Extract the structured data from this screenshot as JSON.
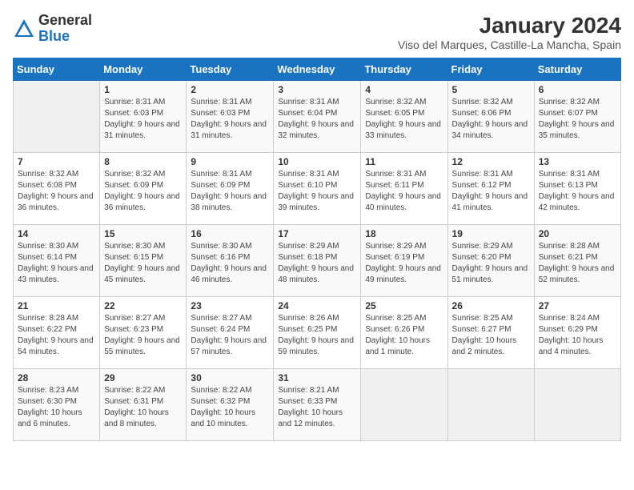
{
  "logo": {
    "general": "General",
    "blue": "Blue"
  },
  "title": "January 2024",
  "subtitle": "Viso del Marques, Castille-La Mancha, Spain",
  "days_of_week": [
    "Sunday",
    "Monday",
    "Tuesday",
    "Wednesday",
    "Thursday",
    "Friday",
    "Saturday"
  ],
  "weeks": [
    [
      {
        "day": "",
        "sunrise": "",
        "sunset": "",
        "daylight": ""
      },
      {
        "day": "1",
        "sunrise": "Sunrise: 8:31 AM",
        "sunset": "Sunset: 6:03 PM",
        "daylight": "Daylight: 9 hours and 31 minutes."
      },
      {
        "day": "2",
        "sunrise": "Sunrise: 8:31 AM",
        "sunset": "Sunset: 6:03 PM",
        "daylight": "Daylight: 9 hours and 31 minutes."
      },
      {
        "day": "3",
        "sunrise": "Sunrise: 8:31 AM",
        "sunset": "Sunset: 6:04 PM",
        "daylight": "Daylight: 9 hours and 32 minutes."
      },
      {
        "day": "4",
        "sunrise": "Sunrise: 8:32 AM",
        "sunset": "Sunset: 6:05 PM",
        "daylight": "Daylight: 9 hours and 33 minutes."
      },
      {
        "day": "5",
        "sunrise": "Sunrise: 8:32 AM",
        "sunset": "Sunset: 6:06 PM",
        "daylight": "Daylight: 9 hours and 34 minutes."
      },
      {
        "day": "6",
        "sunrise": "Sunrise: 8:32 AM",
        "sunset": "Sunset: 6:07 PM",
        "daylight": "Daylight: 9 hours and 35 minutes."
      }
    ],
    [
      {
        "day": "7",
        "sunrise": "Sunrise: 8:32 AM",
        "sunset": "Sunset: 6:08 PM",
        "daylight": "Daylight: 9 hours and 36 minutes."
      },
      {
        "day": "8",
        "sunrise": "Sunrise: 8:32 AM",
        "sunset": "Sunset: 6:09 PM",
        "daylight": "Daylight: 9 hours and 36 minutes."
      },
      {
        "day": "9",
        "sunrise": "Sunrise: 8:31 AM",
        "sunset": "Sunset: 6:09 PM",
        "daylight": "Daylight: 9 hours and 38 minutes."
      },
      {
        "day": "10",
        "sunrise": "Sunrise: 8:31 AM",
        "sunset": "Sunset: 6:10 PM",
        "daylight": "Daylight: 9 hours and 39 minutes."
      },
      {
        "day": "11",
        "sunrise": "Sunrise: 8:31 AM",
        "sunset": "Sunset: 6:11 PM",
        "daylight": "Daylight: 9 hours and 40 minutes."
      },
      {
        "day": "12",
        "sunrise": "Sunrise: 8:31 AM",
        "sunset": "Sunset: 6:12 PM",
        "daylight": "Daylight: 9 hours and 41 minutes."
      },
      {
        "day": "13",
        "sunrise": "Sunrise: 8:31 AM",
        "sunset": "Sunset: 6:13 PM",
        "daylight": "Daylight: 9 hours and 42 minutes."
      }
    ],
    [
      {
        "day": "14",
        "sunrise": "Sunrise: 8:30 AM",
        "sunset": "Sunset: 6:14 PM",
        "daylight": "Daylight: 9 hours and 43 minutes."
      },
      {
        "day": "15",
        "sunrise": "Sunrise: 8:30 AM",
        "sunset": "Sunset: 6:15 PM",
        "daylight": "Daylight: 9 hours and 45 minutes."
      },
      {
        "day": "16",
        "sunrise": "Sunrise: 8:30 AM",
        "sunset": "Sunset: 6:16 PM",
        "daylight": "Daylight: 9 hours and 46 minutes."
      },
      {
        "day": "17",
        "sunrise": "Sunrise: 8:29 AM",
        "sunset": "Sunset: 6:18 PM",
        "daylight": "Daylight: 9 hours and 48 minutes."
      },
      {
        "day": "18",
        "sunrise": "Sunrise: 8:29 AM",
        "sunset": "Sunset: 6:19 PM",
        "daylight": "Daylight: 9 hours and 49 minutes."
      },
      {
        "day": "19",
        "sunrise": "Sunrise: 8:29 AM",
        "sunset": "Sunset: 6:20 PM",
        "daylight": "Daylight: 9 hours and 51 minutes."
      },
      {
        "day": "20",
        "sunrise": "Sunrise: 8:28 AM",
        "sunset": "Sunset: 6:21 PM",
        "daylight": "Daylight: 9 hours and 52 minutes."
      }
    ],
    [
      {
        "day": "21",
        "sunrise": "Sunrise: 8:28 AM",
        "sunset": "Sunset: 6:22 PM",
        "daylight": "Daylight: 9 hours and 54 minutes."
      },
      {
        "day": "22",
        "sunrise": "Sunrise: 8:27 AM",
        "sunset": "Sunset: 6:23 PM",
        "daylight": "Daylight: 9 hours and 55 minutes."
      },
      {
        "day": "23",
        "sunrise": "Sunrise: 8:27 AM",
        "sunset": "Sunset: 6:24 PM",
        "daylight": "Daylight: 9 hours and 57 minutes."
      },
      {
        "day": "24",
        "sunrise": "Sunrise: 8:26 AM",
        "sunset": "Sunset: 6:25 PM",
        "daylight": "Daylight: 9 hours and 59 minutes."
      },
      {
        "day": "25",
        "sunrise": "Sunrise: 8:25 AM",
        "sunset": "Sunset: 6:26 PM",
        "daylight": "Daylight: 10 hours and 1 minute."
      },
      {
        "day": "26",
        "sunrise": "Sunrise: 8:25 AM",
        "sunset": "Sunset: 6:27 PM",
        "daylight": "Daylight: 10 hours and 2 minutes."
      },
      {
        "day": "27",
        "sunrise": "Sunrise: 8:24 AM",
        "sunset": "Sunset: 6:29 PM",
        "daylight": "Daylight: 10 hours and 4 minutes."
      }
    ],
    [
      {
        "day": "28",
        "sunrise": "Sunrise: 8:23 AM",
        "sunset": "Sunset: 6:30 PM",
        "daylight": "Daylight: 10 hours and 6 minutes."
      },
      {
        "day": "29",
        "sunrise": "Sunrise: 8:22 AM",
        "sunset": "Sunset: 6:31 PM",
        "daylight": "Daylight: 10 hours and 8 minutes."
      },
      {
        "day": "30",
        "sunrise": "Sunrise: 8:22 AM",
        "sunset": "Sunset: 6:32 PM",
        "daylight": "Daylight: 10 hours and 10 minutes."
      },
      {
        "day": "31",
        "sunrise": "Sunrise: 8:21 AM",
        "sunset": "Sunset: 6:33 PM",
        "daylight": "Daylight: 10 hours and 12 minutes."
      },
      {
        "day": "",
        "sunrise": "",
        "sunset": "",
        "daylight": ""
      },
      {
        "day": "",
        "sunrise": "",
        "sunset": "",
        "daylight": ""
      },
      {
        "day": "",
        "sunrise": "",
        "sunset": "",
        "daylight": ""
      }
    ]
  ]
}
